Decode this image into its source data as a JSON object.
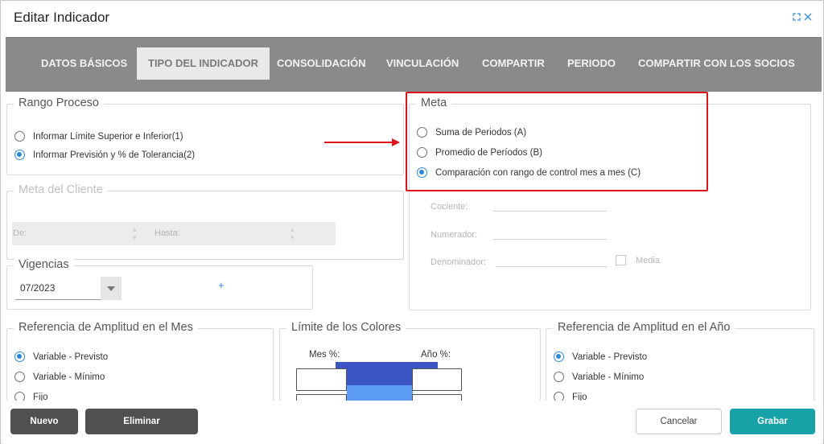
{
  "dialog": {
    "title": "Editar Indicador"
  },
  "tabs": [
    {
      "label": "DATOS BÁSICOS"
    },
    {
      "label": "TIPO DEL INDICADOR"
    },
    {
      "label": "CONSOLIDACIÓN"
    },
    {
      "label": "VINCULACIÓN"
    },
    {
      "label": "COMPARTIR"
    },
    {
      "label": "PERIODO"
    },
    {
      "label": "COMPARTIR CON LOS SOCIOS"
    }
  ],
  "rango_proceso": {
    "legend": "Rango Proceso",
    "options": [
      {
        "label": "Informar Límite Superior e Inferior(1)",
        "checked": false
      },
      {
        "label": "Informar Previsión y % de Tolerancia(2)",
        "checked": true
      }
    ]
  },
  "meta": {
    "legend": "Meta",
    "options": [
      {
        "label": "Suma de Periodos (A)",
        "checked": false
      },
      {
        "label": "Promedio de Períodos (B)",
        "checked": false
      },
      {
        "label": "Comparación con rango de control mes a mes (C)",
        "checked": true
      }
    ],
    "cociente_label": "Cociente:",
    "numerador_label": "Numerador:",
    "denominador_label": "Denominador:",
    "media_label": "Media"
  },
  "meta_cliente": {
    "legend": "Meta del Cliente",
    "de_label": "De:",
    "hasta_label": "Hasta:"
  },
  "vigencias": {
    "legend": "Vigencias",
    "value": "07/2023",
    "add_symbol": "+"
  },
  "ref_mes": {
    "legend": "Referencia de Amplitud en el Mes",
    "options": [
      {
        "label": "Variable - Previsto",
        "checked": true
      },
      {
        "label": "Variable - Mínimo",
        "checked": false
      },
      {
        "label": "Fijo",
        "checked": false
      }
    ]
  },
  "limite_colores": {
    "legend": "Límite de los Colores",
    "mes_label": "Mes %:",
    "anio_label": "Año %:",
    "colors": {
      "top": "#3d56c5",
      "mid": "#5b9bf3"
    }
  },
  "ref_anio": {
    "legend": "Referencia de Amplitud en el Año",
    "options": [
      {
        "label": "Variable - Previsto",
        "checked": true
      },
      {
        "label": "Variable - Mínimo",
        "checked": false
      },
      {
        "label": "Fijo",
        "checked": false
      }
    ]
  },
  "footer": {
    "nuevo": "Nuevo",
    "eliminar": "Eliminar",
    "cancelar": "Cancelar",
    "grabar": "Grabar"
  },
  "colors": {
    "accent": "#2d89d8",
    "teal": "#17a2a8",
    "annotation": "#e0141c"
  }
}
